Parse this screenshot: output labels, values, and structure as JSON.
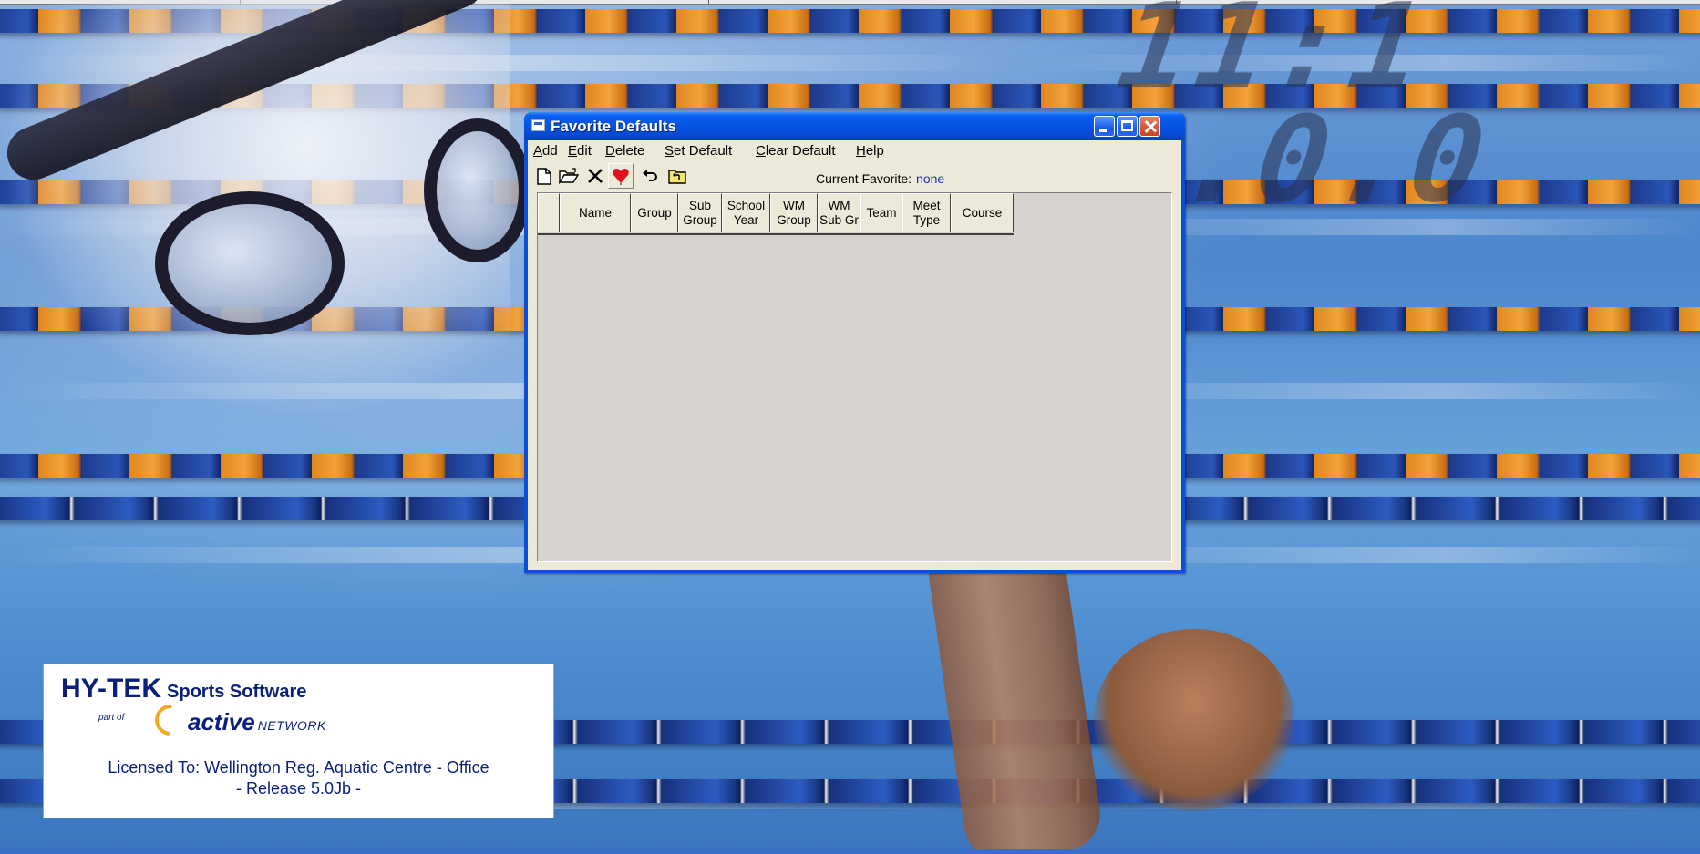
{
  "background": {
    "clock_text": "11:1\n1.0.0"
  },
  "dialog": {
    "title": "Favorite Defaults",
    "menu": [
      {
        "label": "Add",
        "accel": "A",
        "rest": "dd"
      },
      {
        "label": "Edit",
        "accel": "E",
        "rest": "dit"
      },
      {
        "label": "Delete",
        "accel": "D",
        "rest": "elete"
      },
      {
        "label": "Set Default",
        "accel": "S",
        "rest": "et Default"
      },
      {
        "label": "Clear Default",
        "accel": "C",
        "rest": "lear Default"
      },
      {
        "label": "Help",
        "accel": "H",
        "rest": "elp"
      }
    ],
    "toolbar": {
      "icons": [
        "new-document-icon",
        "open-folder-icon",
        "delete-x-icon",
        "heart-favorite-icon",
        "undo-icon",
        "back-folder-icon"
      ],
      "current_favorite_label": "Current Favorite:",
      "current_favorite_value": "none"
    },
    "grid": {
      "columns": [
        {
          "line1": "",
          "line2": ""
        },
        {
          "line1": "Name",
          "line2": ""
        },
        {
          "line1": "Group",
          "line2": ""
        },
        {
          "line1": "Sub",
          "line2": "Group"
        },
        {
          "line1": "School",
          "line2": "Year"
        },
        {
          "line1": "WM",
          "line2": "Group"
        },
        {
          "line1": "WM",
          "line2": "Sub Gr"
        },
        {
          "line1": "Team",
          "line2": ""
        },
        {
          "line1": "Meet",
          "line2": "Type"
        },
        {
          "line1": "Course",
          "line2": ""
        }
      ],
      "rows": []
    },
    "colors": {
      "titlebar": "#0553e3",
      "client": "#ece9d8",
      "grid_bg": "#d6d3ce",
      "favorite_value": "#1a2fbf"
    }
  },
  "license": {
    "brand": "HY-TEK",
    "brand_sub": "Sports Software",
    "part_of": "part of",
    "active": "active",
    "network": "NETWORK",
    "line1": "Licensed To:  Wellington Reg. Aquatic Centre - Office",
    "line2": "- Release 5.0Jb -"
  }
}
